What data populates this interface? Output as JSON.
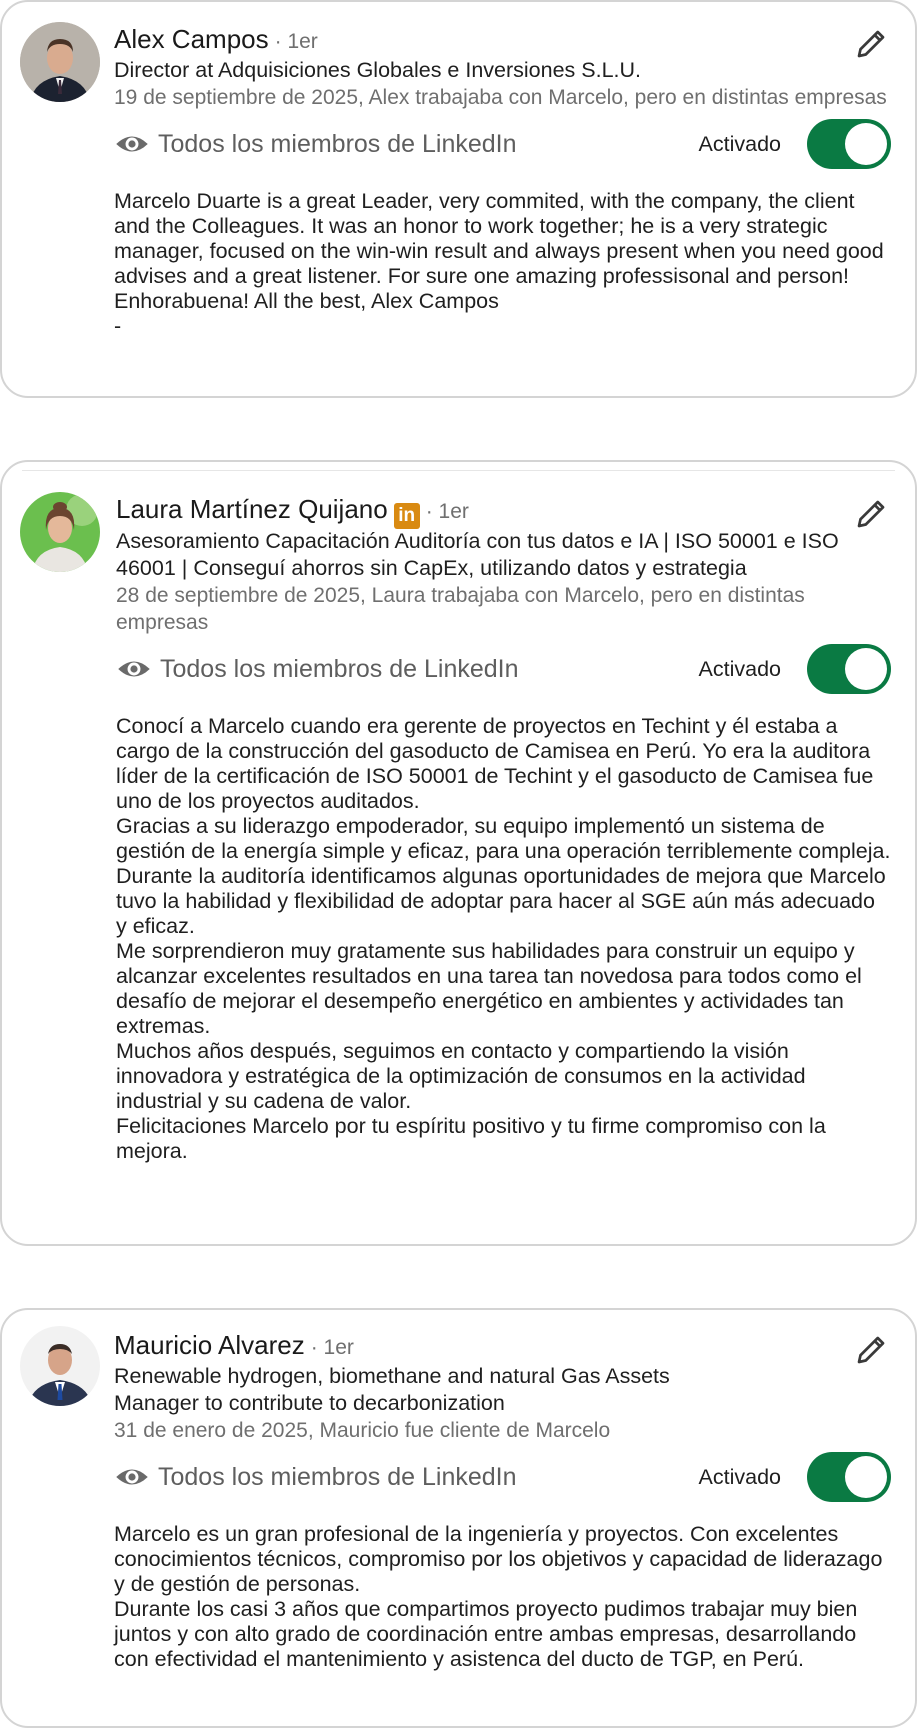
{
  "colors": {
    "toggle_on": "#0a7a43",
    "muted_text": "#6f6f6f",
    "card_border": "#d4d4d4",
    "linkedin_badge": "#d98a12"
  },
  "recommendations": [
    {
      "name": "Alex Campos",
      "degree": "· 1er",
      "headline": "Director at Adquisiciones Globales e Inversiones S.L.U.",
      "meta": "19 de septiembre de 2025, Alex trabajaba con Marcelo, pero en distintas empresas",
      "visibility": "Todos los miembros de LinkedIn",
      "toggle_label": "Activado",
      "toggle_state": "on",
      "body": [
        "Marcelo Duarte is a great Leader, very commited, with the company, the client and the Colleagues. It was an honor to work together; he is a very strategic manager, focused on the win-win result and always present when you need good advises and a great listener. For sure one amazing professisonal and person! Enhorabuena! All the best, Alex Campos",
        "-"
      ]
    },
    {
      "name": "Laura Martínez Quijano",
      "badge": "in",
      "degree": "· 1er",
      "headline": "Asesoramiento Capacitación Auditoría con tus datos e IA | ISO 50001 e ISO 46001 | Conseguí ahorros sin CapEx, utilizando datos y estrategia",
      "meta": "28 de septiembre de 2025, Laura trabajaba con Marcelo, pero en distintas empresas",
      "visibility": "Todos los miembros de LinkedIn",
      "toggle_label": "Activado",
      "toggle_state": "on",
      "body": [
        "Conocí a Marcelo cuando era gerente de proyectos en Techint y él estaba a cargo de la construcción del gasoducto de Camisea en Perú. Yo era la auditora líder de la certificación de ISO 50001 de Techint y el gasoducto de Camisea fue uno de los proyectos auditados.",
        "Gracias a su liderazgo empoderador, su equipo implementó un sistema de gestión de la energía simple y eficaz, para una operación terriblemente compleja. Durante la auditoría identificamos algunas oportunidades de mejora que Marcelo tuvo la habilidad y flexibilidad de adoptar para hacer al SGE aún más adecuado y eficaz.",
        "Me sorprendieron muy gratamente sus habilidades para construir un equipo y alcanzar excelentes resultados en una tarea tan novedosa para todos como el desafío de mejorar el desempeño energético en ambientes y actividades tan extremas.",
        "Muchos años después, seguimos en contacto y compartiendo la visión innovadora y estratégica de la optimización de consumos en la actividad industrial y su cadena de valor.",
        "Felicitaciones Marcelo por tu espíritu positivo y tu firme compromiso con la mejora."
      ]
    },
    {
      "name": "Mauricio Alvarez",
      "degree": "· 1er",
      "headline": "Renewable hydrogen, biomethane and natural Gas Assets Manager to contribute to decarbonization",
      "meta": "31 de enero de 2025, Mauricio fue cliente de Marcelo",
      "visibility": "Todos los miembros de LinkedIn",
      "toggle_label": "Activado",
      "toggle_state": "on",
      "body": [
        "Marcelo es un gran profesional de la ingeniería y proyectos. Con excelentes conocimientos técnicos, compromiso por los objetivos y capacidad de liderazago y de gestión de personas.",
        "Durante los casi 3 años que compartimos proyecto pudimos trabajar muy bien juntos y con alto grado de coordinación entre ambas empresas, desarrollando con efectividad el mantenimiento y asistenca del ducto de TGP, en Perú."
      ]
    }
  ]
}
